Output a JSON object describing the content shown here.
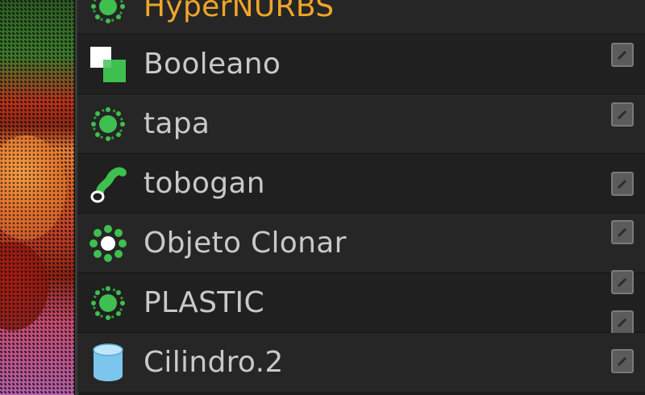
{
  "viewport": {
    "description_icon": "viewport-render"
  },
  "objects": [
    {
      "label": "HyperNURBS",
      "icon": "hypernurbs-icon",
      "active": true,
      "edit_icon": "edit-pencil-icon"
    },
    {
      "label": "Booleano",
      "icon": "boolean-icon",
      "active": false,
      "edit_icon": "edit-pencil-icon"
    },
    {
      "label": "tapa",
      "icon": "hypernurbs-icon",
      "active": false,
      "edit_icon": "edit-pencil-icon"
    },
    {
      "label": "tobogan",
      "icon": "sweep-icon",
      "active": false,
      "edit_icon": "edit-pencil-icon"
    },
    {
      "label": "Objeto Clonar",
      "icon": "cloner-icon",
      "active": false,
      "edit_icon": "edit-pencil-icon"
    },
    {
      "label": "PLASTIC",
      "icon": "hypernurbs-icon",
      "active": false,
      "edit_icon": "edit-pencil-icon"
    },
    {
      "label": "Cilindro.2",
      "icon": "cylinder-icon",
      "active": false,
      "edit_icon": "edit-pencil-icon"
    }
  ],
  "colors": {
    "active_label": "#f0a52a",
    "label": "#c9c9c9",
    "icon_green": "#3fbf4f",
    "cylinder_blue": "#7cc6ee"
  }
}
